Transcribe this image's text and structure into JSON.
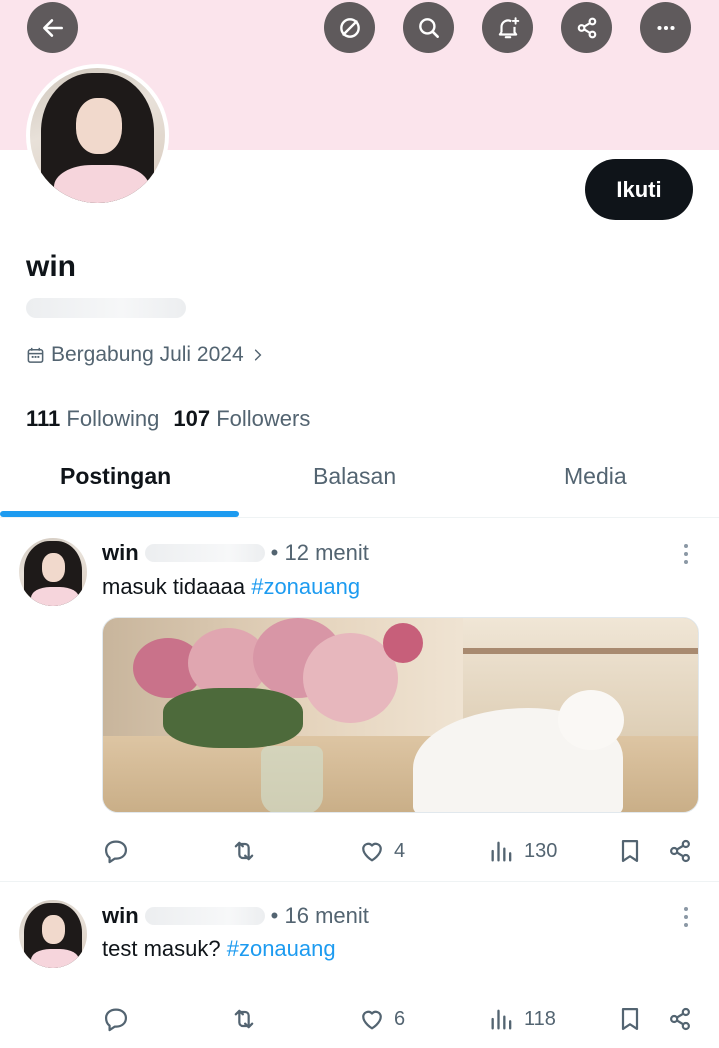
{
  "profile": {
    "name": "win",
    "joined": "Bergabung Juli 2024",
    "following_count": "111",
    "following_label": "Following",
    "followers_count": "107",
    "followers_label": "Followers",
    "follow_button": "Ikuti"
  },
  "tabs": [
    {
      "label": "Postingan",
      "active": true
    },
    {
      "label": "Balasan",
      "active": false
    },
    {
      "label": "Media",
      "active": false
    }
  ],
  "posts": [
    {
      "author": "win",
      "time": "• 12 menit",
      "text": "masuk tidaaaa ",
      "hashtag": "#zonauang",
      "likes": "4",
      "views": "130",
      "has_media": true
    },
    {
      "author": "win",
      "time": "• 16 menit",
      "text": "test masuk? ",
      "hashtag": "#zonauang",
      "likes": "6",
      "views": "118",
      "has_media": false
    }
  ],
  "icons": {
    "back": "arrow-left-icon",
    "grok": "grok-icon",
    "search": "search-icon",
    "notify": "bell-plus-icon",
    "share": "share-icon",
    "more": "more-icon"
  },
  "colors": {
    "accent": "#1d9bf0",
    "banner": "#fbe4ec",
    "text_secondary": "#536471"
  }
}
